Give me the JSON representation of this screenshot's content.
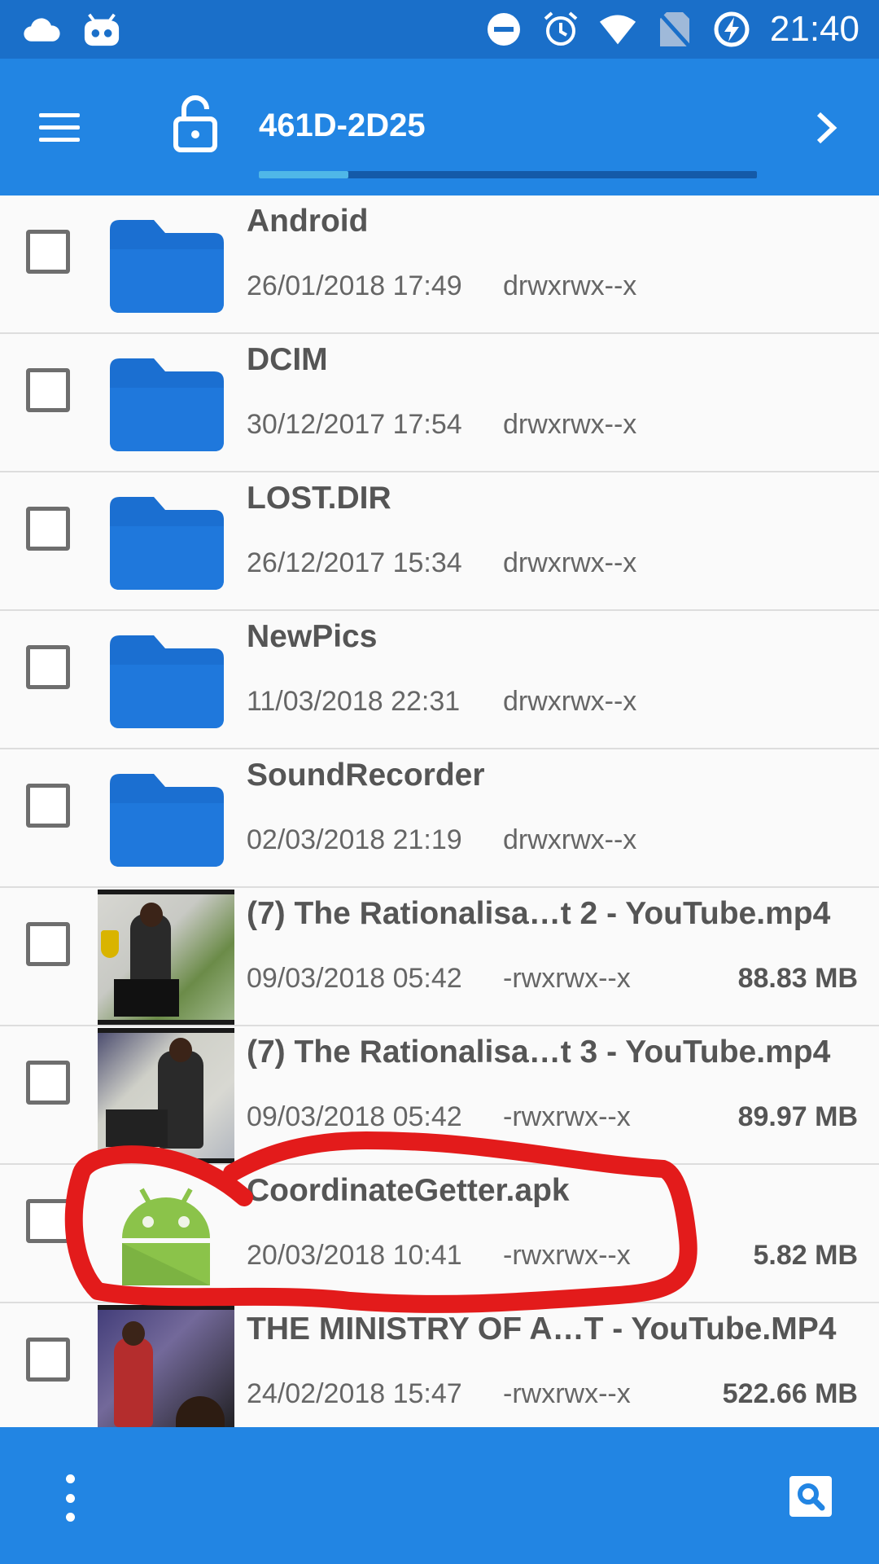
{
  "status_bar": {
    "time": "21:40",
    "left_icons": [
      "cloud-icon",
      "bot-icon"
    ],
    "right_icons": [
      "do-not-disturb-icon",
      "alarm-icon",
      "wifi-icon",
      "no-sim-icon",
      "battery-charging-icon"
    ]
  },
  "app_bar": {
    "path": "461D-2D25",
    "path_progress": 0.18,
    "icons": [
      "menu-icon",
      "lock-open-icon",
      "chevron-right-icon"
    ]
  },
  "files": [
    {
      "name": "Android",
      "date": "26/01/2018 17:49",
      "perm": "drwxrwx--x",
      "size": "",
      "kind": "folder"
    },
    {
      "name": "DCIM",
      "date": "30/12/2017 17:54",
      "perm": "drwxrwx--x",
      "size": "",
      "kind": "folder"
    },
    {
      "name": "LOST.DIR",
      "date": "26/12/2017 15:34",
      "perm": "drwxrwx--x",
      "size": "",
      "kind": "folder"
    },
    {
      "name": "NewPics",
      "date": "11/03/2018 22:31",
      "perm": "drwxrwx--x",
      "size": "",
      "kind": "folder"
    },
    {
      "name": "SoundRecorder",
      "date": "02/03/2018 21:19",
      "perm": "drwxrwx--x",
      "size": "",
      "kind": "folder"
    },
    {
      "name": "(7) The Rationalisa…t 2 - YouTube.mp4",
      "date": "09/03/2018 05:42",
      "perm": "-rwxrwx--x",
      "size": "88.83 MB",
      "kind": "video"
    },
    {
      "name": "(7) The Rationalisa…t 3 - YouTube.mp4",
      "date": "09/03/2018 05:42",
      "perm": "-rwxrwx--x",
      "size": "89.97 MB",
      "kind": "video"
    },
    {
      "name": "CoordinateGetter.apk",
      "date": "20/03/2018 10:41",
      "perm": "-rwxrwx--x",
      "size": "5.82 MB",
      "kind": "apk"
    },
    {
      "name": "THE MINISTRY OF A…T - YouTube.MP4",
      "date": "24/02/2018 15:47",
      "perm": "-rwxrwx--x",
      "size": "522.66 MB",
      "kind": "video"
    }
  ],
  "bottom_bar": {
    "icons": [
      "overflow-menu-icon",
      "search-icon"
    ]
  },
  "colors": {
    "status_bar": "#1a6fc9",
    "app_bar": "#2285e3",
    "folder": "#1b6fd1",
    "annotation": "#e31b1b"
  }
}
